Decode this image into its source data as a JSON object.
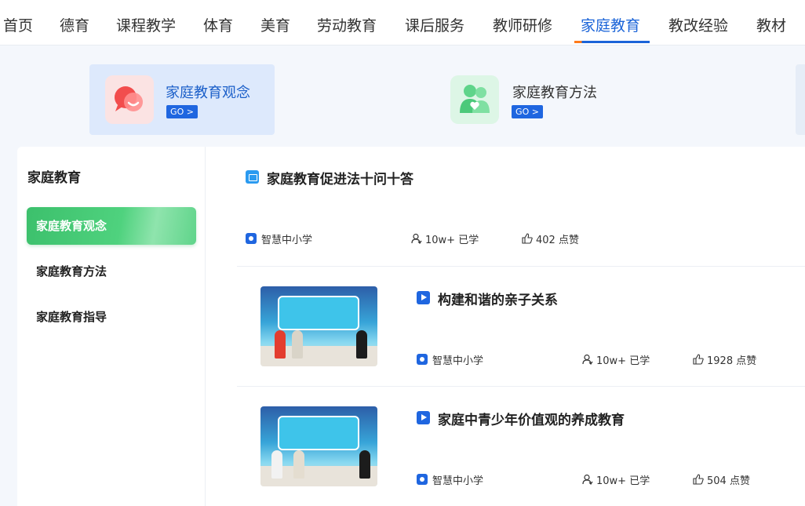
{
  "nav": {
    "items": [
      "首页",
      "德育",
      "课程教学",
      "体育",
      "美育",
      "劳动教育",
      "课后服务",
      "教师研修",
      "家庭教育",
      "教改经验",
      "教材"
    ],
    "active": "家庭教育"
  },
  "categories": [
    {
      "title": "家庭教育观念",
      "go": "GO >",
      "icon": "chat-heart-icon",
      "active": true
    },
    {
      "title": "家庭教育方法",
      "go": "GO >",
      "icon": "family-heart-icon",
      "active": false
    }
  ],
  "sidebar": {
    "title": "家庭教育",
    "items": [
      {
        "label": "家庭教育观念",
        "active": true
      },
      {
        "label": "家庭教育方法",
        "active": false
      },
      {
        "label": "家庭教育指导",
        "active": false
      }
    ]
  },
  "resources": [
    {
      "title": "家庭教育促进法十问十答",
      "type": "image",
      "source": "智慧中小学",
      "learners": "10w+ 已学",
      "likes": "402 点赞"
    },
    {
      "title": "构建和谐的亲子关系",
      "type": "video",
      "source": "智慧中小学",
      "learners": "10w+ 已学",
      "likes": "1928 点赞"
    },
    {
      "title": "家庭中青少年价值观的养成教育",
      "type": "video",
      "source": "智慧中小学",
      "learners": "10w+ 已学",
      "likes": "504 点赞"
    }
  ],
  "colors": {
    "accent": "#1b64d8",
    "active_green": "#3cc06c",
    "page_bg": "#f4f7fc"
  }
}
